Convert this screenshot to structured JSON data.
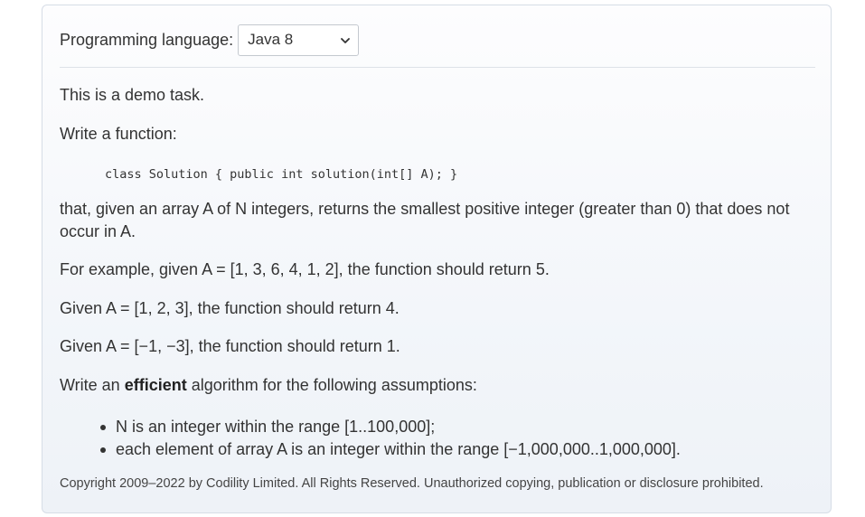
{
  "language_selector": {
    "label": "Programming language:",
    "selected": "Java 8"
  },
  "task": {
    "intro": "This is a demo task.",
    "write_function": "Write a function:",
    "signature": "class Solution { public int solution(int[] A); }",
    "description": "that, given an array A of N integers, returns the smallest positive integer (greater than 0) that does not occur in A.",
    "example_1": "For example, given A = [1, 3, 6, 4, 1, 2], the function should return 5.",
    "example_2": "Given A = [1, 2, 3], the function should return 4.",
    "example_3": "Given A = [−1, −3], the function should return 1.",
    "efficient_prefix": "Write an ",
    "efficient_bold": "efficient",
    "efficient_suffix": " algorithm for the following assumptions:",
    "assumptions": [
      "N is an integer within the range [1..100,000];",
      "each element of array A is an integer within the range [−1,000,000..1,000,000]."
    ]
  },
  "footer": {
    "copyright": "Copyright 2009–2022 by Codility Limited. All Rights Reserved. Unauthorized copying, publication or disclosure prohibited."
  }
}
